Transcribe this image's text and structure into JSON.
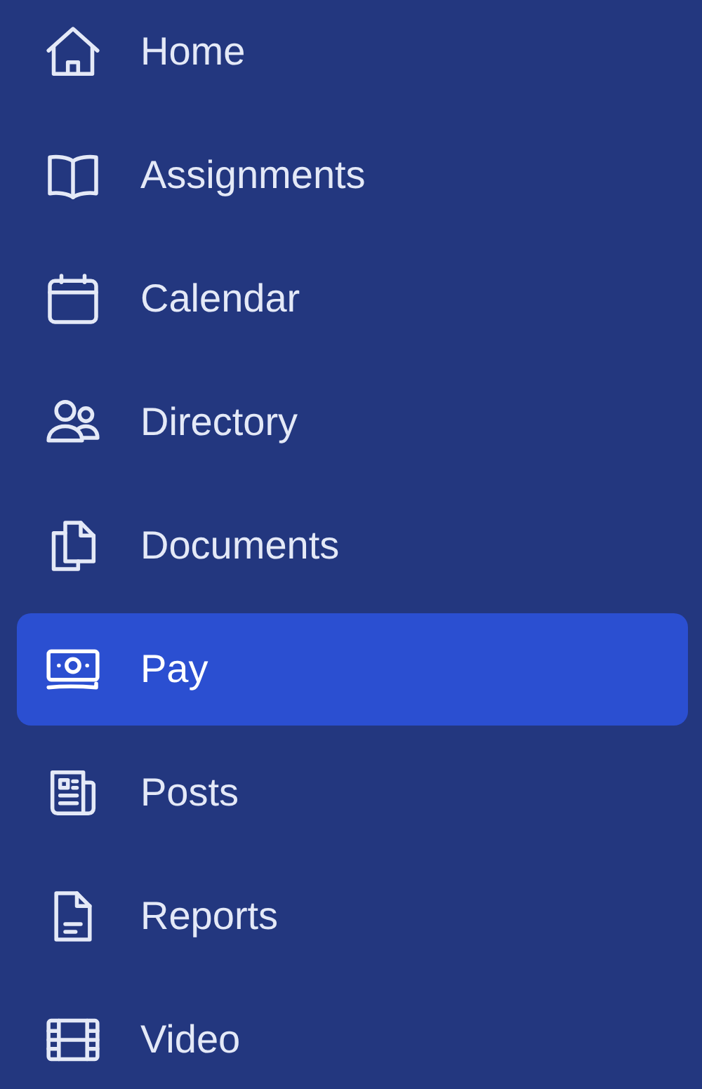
{
  "nav_items": [
    {
      "label": "Home",
      "selected": false
    },
    {
      "label": "Assignments",
      "selected": false
    },
    {
      "label": "Calendar",
      "selected": false
    },
    {
      "label": "Directory",
      "selected": false
    },
    {
      "label": "Documents",
      "selected": false
    },
    {
      "label": "Pay",
      "selected": true
    },
    {
      "label": "Posts",
      "selected": false
    },
    {
      "label": "Reports",
      "selected": false
    },
    {
      "label": "Video",
      "selected": false
    }
  ]
}
